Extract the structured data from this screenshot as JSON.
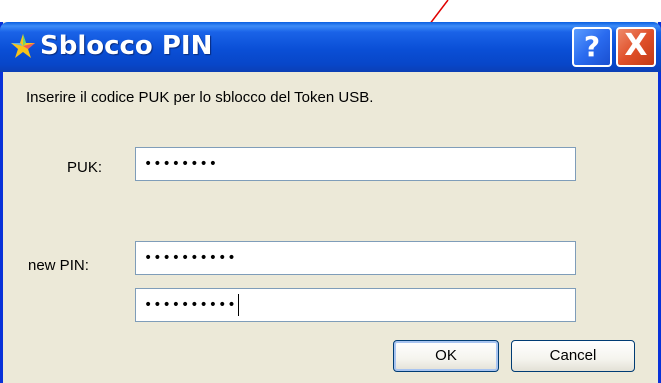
{
  "dialog": {
    "title": "Sblocco PIN",
    "help_label": "?",
    "close_label": "X",
    "instructions": "Inserire il codice PUK per lo sblocco del Token USB.",
    "puk_label": "PUK:",
    "puk_value": "••••••••",
    "new_pin_label": "new PIN:",
    "new_pin_value": "••••••••••",
    "confirm_pin_value": "••••••••••",
    "ok_label": "OK",
    "cancel_label": "Cancel"
  },
  "icons": {
    "title_icon": "star-icon",
    "help_icon": "help-icon",
    "close_icon": "close-icon"
  },
  "colors": {
    "titlebar": "#0a4fd6",
    "window_border": "#0831d9",
    "dialog_background": "#ece9d8",
    "close_button": "#e0502a",
    "annotation_arrow": "#e00000"
  }
}
